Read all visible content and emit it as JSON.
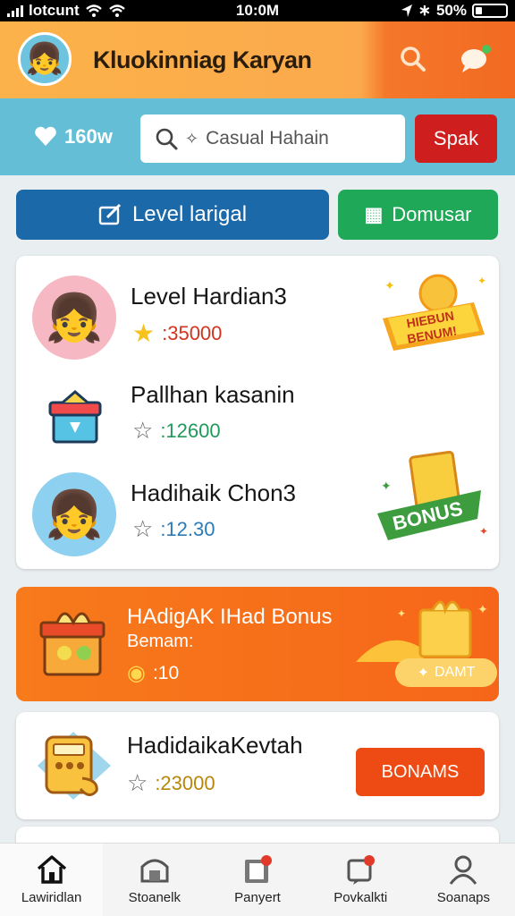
{
  "status": {
    "carrier": "lotcunt",
    "time": "10:0M",
    "battery": "50%"
  },
  "header": {
    "title": "Kluokinniag Karyan",
    "avatar_icon": "girl-avatar-icon",
    "search_icon": "search-icon",
    "chat_icon": "chat-icon"
  },
  "strip": {
    "hearts": "160w",
    "search_placeholder": "Casual Hahain",
    "search_button": "Spak"
  },
  "tabs": {
    "level": "Level larigal",
    "bonus": "Domusar"
  },
  "list": [
    {
      "name": "Level Hardian3",
      "points": ":35000",
      "icon": "girl-avatar-icon",
      "badge_text_1": "HIEBUN",
      "badge_text_2": "BENUM!"
    },
    {
      "name": "Pallhan kasanin",
      "points": ":12600",
      "icon": "gift-box-icon"
    },
    {
      "name": "Hadihaik Chon3",
      "points": ":12.30",
      "icon": "girl-avatar-icon",
      "badge_text_1": "BONUS"
    }
  ],
  "promo": {
    "title": "HAdigAK IHad Bonus",
    "subtitle": "Bemam:",
    "points": ":10",
    "button": "DAMT"
  },
  "reward": {
    "name": "HadidaikaKevtah",
    "points": ":23000",
    "button": "BONAMS"
  },
  "nav": [
    {
      "label": "Lawiridlan",
      "icon": "home-icon"
    },
    {
      "label": "Stoanelk",
      "icon": "store-icon"
    },
    {
      "label": "Panyert",
      "icon": "bag-icon"
    },
    {
      "label": "Povkalkti",
      "icon": "notification-icon"
    },
    {
      "label": "Soanaps",
      "icon": "profile-icon"
    }
  ],
  "colors": {
    "header": "#fcb24a",
    "strip": "#64bfd6",
    "level_tab": "#1b69a8",
    "bonus_tab": "#1ea858",
    "search_button": "#cf1e1e",
    "promo": "#f77a1b"
  }
}
